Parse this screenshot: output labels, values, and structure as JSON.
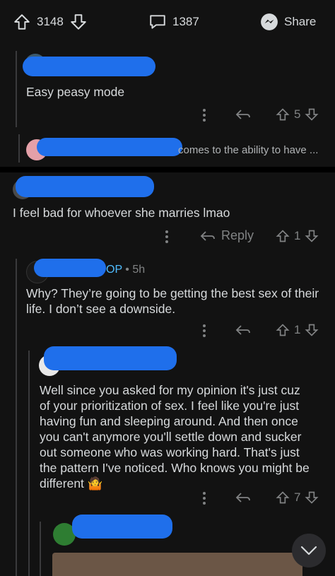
{
  "topbar": {
    "upvotes": "3148",
    "comments": "1387",
    "share_label": "Share"
  },
  "comment1": {
    "body": "Easy peasy mode",
    "votes": "5"
  },
  "collapsed": {
    "snippet": "comes to the ability to have ..."
  },
  "comment2": {
    "body": "I feel bad for whoever she marries lmao",
    "reply_label": "Reply",
    "votes": "1"
  },
  "comment3": {
    "op_badge": "OP",
    "age": "• 5h",
    "body": "Why? They’re going to be getting the best sex of their life. I don’t see a downside.",
    "votes": "1"
  },
  "comment4": {
    "lines": [
      "Well since you asked for my opinion it's just cuz",
      "of your prioritization of sex. I feel like you're just",
      "having fun and sleeping around. And then once",
      "you can't anymore you'll settle down and sucker",
      "out someone who was working hard. That's just",
      "the pattern I've noticed. Who knows you might be",
      "different"
    ],
    "emoji": "🤷",
    "votes": "7"
  },
  "colors": {
    "background": "#121212",
    "text": "#d7dadc",
    "muted": "#818384",
    "op": "#4fbcff",
    "redaction": "#1f6feb"
  }
}
